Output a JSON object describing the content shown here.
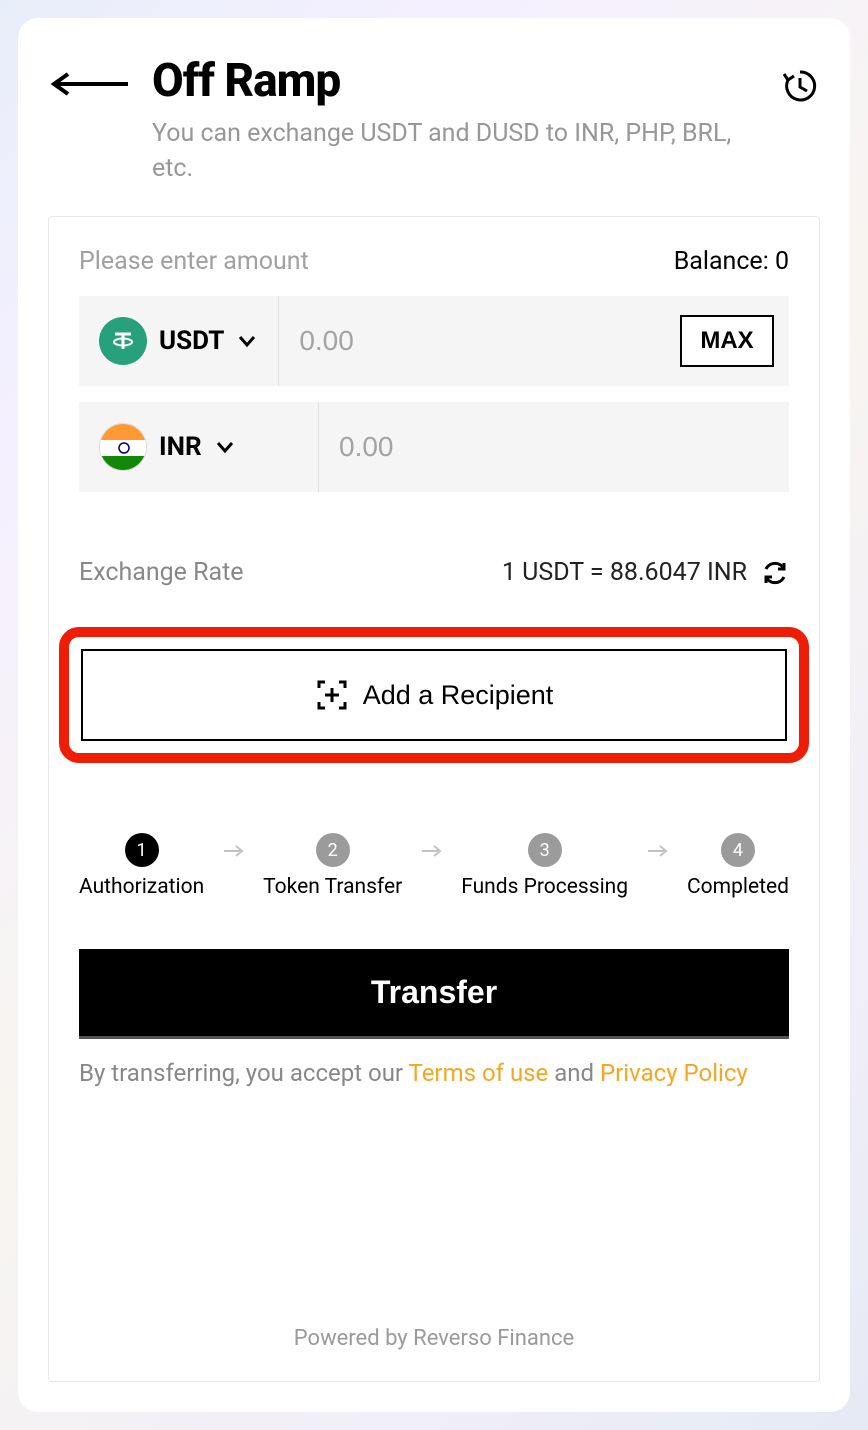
{
  "header": {
    "title": "Off Ramp",
    "subtitle": "You can exchange USDT and DUSD to INR, PHP, BRL, etc."
  },
  "form": {
    "amount_label": "Please enter amount",
    "balance_label": "Balance: 0",
    "from_currency": "USDT",
    "to_currency": "INR",
    "amount_placeholder": "0.00",
    "receive_placeholder": "0.00",
    "max_label": "MAX"
  },
  "rate": {
    "label": "Exchange Rate",
    "value": "1 USDT = 88.6047 INR"
  },
  "recipient": {
    "add_label": "Add a Recipient"
  },
  "steps": [
    {
      "num": "1",
      "label": "Authorization",
      "active": true
    },
    {
      "num": "2",
      "label": "Token Transfer",
      "active": false
    },
    {
      "num": "3",
      "label": "Funds Processing",
      "active": false
    },
    {
      "num": "4",
      "label": "Completed",
      "active": false
    }
  ],
  "actions": {
    "transfer_label": "Transfer"
  },
  "legal": {
    "prefix": "By transferring, you accept our ",
    "terms": "Terms of use",
    "mid": " and ",
    "privacy": "Privacy Policy"
  },
  "footer": "Powered by Reverso Finance"
}
